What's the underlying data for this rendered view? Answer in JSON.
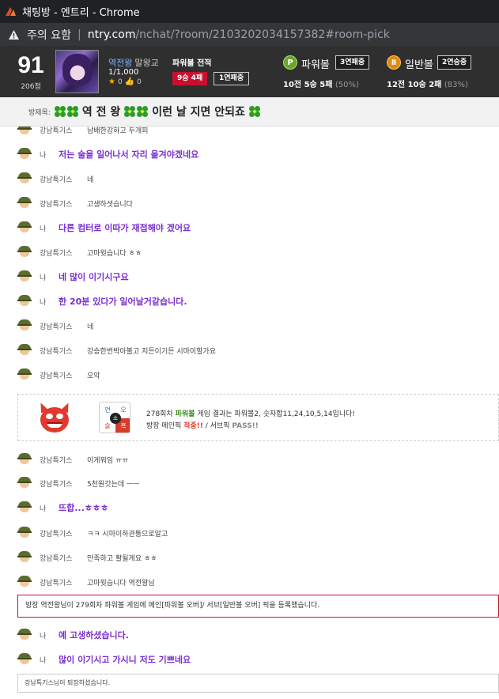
{
  "window": {
    "tab_title": "채팅방 - 엔트리 - Chrome"
  },
  "address_bar": {
    "warning": "주의 요함",
    "separator": "|",
    "host": "ntry.com",
    "path": "/nchat/?room/2103202034157382#room-pick"
  },
  "profile": {
    "level": "91",
    "points": "206점",
    "nickname": "역전왕",
    "title": "말왕교",
    "rank": "1/1,000",
    "stars": "0",
    "likes": "0",
    "record_title": "파워볼 전적",
    "record_main": "9승 4패",
    "record_streak": "1연패중",
    "powerball": {
      "icon_letter": "P",
      "label": "파워볼",
      "streak": "3연패중",
      "record": "10전 5승 5패",
      "rate": "(50%)"
    },
    "general": {
      "icon_letter": "Ⅱ",
      "label": "일반볼",
      "streak": "2연승중",
      "record": "12전 10승 2패",
      "rate": "(83%)"
    }
  },
  "room": {
    "label": "방제목:",
    "title_part1": "역 전 왕",
    "title_part2": "이런 날 지면 안되죠"
  },
  "messages": [
    {
      "nick": "강남특기스",
      "text": "남배한강하고 두개피",
      "me": false
    },
    {
      "nick": "나",
      "text": "저는 술을 일어나서 자리 옮겨야겠네요",
      "me": true
    },
    {
      "nick": "강남특기스",
      "text": "네",
      "me": false
    },
    {
      "nick": "강남특기스",
      "text": "고생하셧습니다",
      "me": false
    },
    {
      "nick": "나",
      "text": "다른 컴터로 이따가 재접해야 겠어요",
      "me": true
    },
    {
      "nick": "강남특기스",
      "text": "고마웟습니다 ㅎㅎ",
      "me": false
    },
    {
      "nick": "나",
      "text": "네 많이 이기시구요",
      "me": true
    },
    {
      "nick": "나",
      "text": "한 20분 있다가 일어날거같습니다.",
      "me": true
    },
    {
      "nick": "강남특기스",
      "text": "네",
      "me": false
    },
    {
      "nick": "강남특기스",
      "text": "강승한번박아볼고 지든이기든 시마이할가요",
      "me": false
    },
    {
      "nick": "강남특기스",
      "text": "오악",
      "me": false
    },
    {
      "nick": "강남특기스",
      "text": "이게뭐임 ㅠㅠ",
      "me": false
    },
    {
      "nick": "강남특기스",
      "text": "5천원갓는데 ㅡㅡ",
      "me": false
    },
    {
      "nick": "나",
      "text": "뜨합...ㅎㅎㅎ",
      "me": true
    },
    {
      "nick": "강남특기스",
      "text": "ㅋㅋ 시마이하관퉁으로알고",
      "me": false
    },
    {
      "nick": "강남특기스",
      "text": "만족하고 활될게요 ㅎㅎ",
      "me": false
    },
    {
      "nick": "강남특기스",
      "text": "고마웟습니다 역전왕님",
      "me": false
    },
    {
      "nick": "나",
      "text": "예 고생하셨습니다.",
      "me": true
    },
    {
      "nick": "나",
      "text": "많이 이기시고 가시니 저도 기쁘네요",
      "me": true
    }
  ],
  "result": {
    "line1_prefix": "278회차 ",
    "line1_game": "파워볼",
    "line1_suffix": " 게임 결과는 파워볼2, 숫자합11,24,10,5,14입니다!",
    "line2_prefix": "방장 메인픽 ",
    "line2_hit": "적중!!",
    "line2_mid": " / 서브픽 ",
    "line2_pass": "PASS!!",
    "oe": {
      "tl": "언",
      "tr": "오",
      "bl": "술",
      "br": "흑",
      "center": "소"
    }
  },
  "pick_notice": "방장 역전왕님이 279회차 파워볼 게임에 메인[파워볼 오버]/ 서브[일반볼 오버] 픽을 등록했습니다.",
  "leave_notice": "강남특기스님이 퇴장하셨습니다."
}
